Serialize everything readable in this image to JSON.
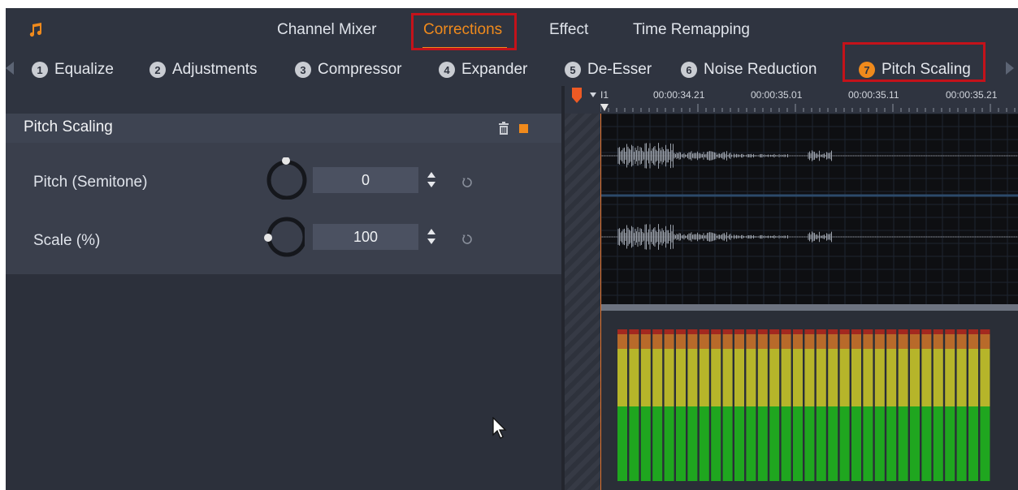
{
  "top_tabs": {
    "items": [
      {
        "label": "Channel Mixer"
      },
      {
        "label": "Corrections"
      },
      {
        "label": "Effect"
      },
      {
        "label": "Time Remapping"
      }
    ],
    "active": "Corrections"
  },
  "sub_tabs": {
    "items": [
      {
        "number": "1",
        "label": "Equalize"
      },
      {
        "number": "2",
        "label": "Adjustments"
      },
      {
        "number": "3",
        "label": "Compressor"
      },
      {
        "number": "4",
        "label": "Expander"
      },
      {
        "number": "5",
        "label": "De-Esser"
      },
      {
        "number": "6",
        "label": "Noise Reduction"
      },
      {
        "number": "7",
        "label": "Pitch Scaling"
      }
    ],
    "active": "Pitch Scaling"
  },
  "panel": {
    "title": "Pitch Scaling",
    "params": [
      {
        "label": "Pitch (Semitone)",
        "value": "0"
      },
      {
        "label": "Scale (%)",
        "value": "100"
      }
    ]
  },
  "timeline": {
    "marker": "I1",
    "timecodes": [
      "00:00:34.21",
      "00:00:35.01",
      "00:00:35.11",
      "00:00:35.21"
    ]
  },
  "colors": {
    "accent": "#f08a1c",
    "highlight_box": "#c4121a",
    "meter_green": "#1fa61f",
    "meter_yellow": "#b6b52a",
    "meter_orange": "#b86a2a",
    "meter_red": "#a3281f"
  },
  "icons": [
    "music-note-icon",
    "trash-icon",
    "reset-icon",
    "spinner-icon",
    "mouse-cursor-icon"
  ]
}
